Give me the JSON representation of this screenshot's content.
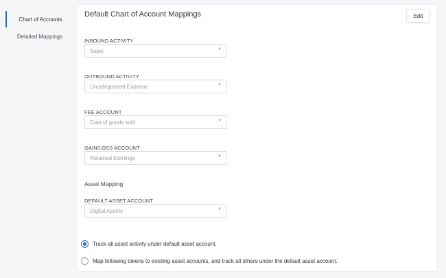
{
  "sidebar": {
    "items": [
      {
        "label": "Chart of Accounts",
        "active": true
      },
      {
        "label": "Detailed Mappings",
        "active": false
      }
    ]
  },
  "panel": {
    "title": "Default Chart of Account Mappings",
    "edit_label": "Edit"
  },
  "fields": [
    {
      "label": "INBOUND ACTIVITY",
      "value": "Sales"
    },
    {
      "label": "OUTBOUND ACTIVITY",
      "value": "Uncategorized Expense"
    },
    {
      "label": "FEE ACCOUNT",
      "value": "Cost of goods sold"
    },
    {
      "label": "GAIN/LOSS ACCOUNT",
      "value": "Retained Earnings"
    }
  ],
  "asset_mapping": {
    "heading": "Asset Mapping",
    "default_label": "DEFAULT ASSET ACCOUNT",
    "default_value": "Digital Assets",
    "options": [
      {
        "label": "Track all asset activity under default asset account.",
        "checked": true
      },
      {
        "label": "Map following tokens to existing asset accounts, and track all others under the default asset account.",
        "checked": false
      }
    ]
  },
  "colors": {
    "accent": "#2b6cb0",
    "page_bg": "#f5f6f8",
    "panel_bg": "#ffffff"
  },
  "icons": {
    "select_chevron": "chevron-down-icon"
  }
}
